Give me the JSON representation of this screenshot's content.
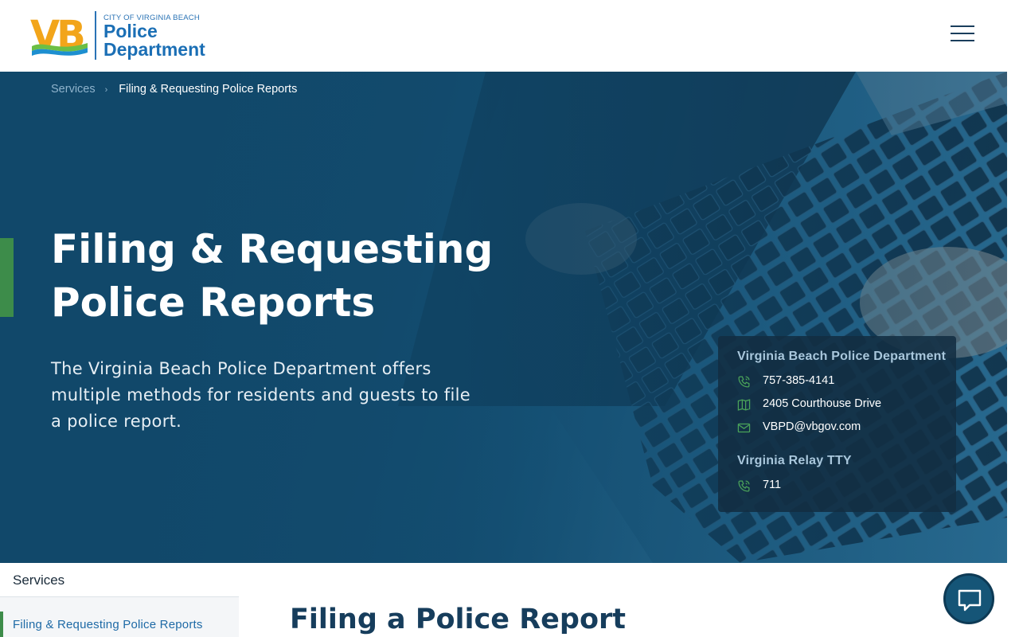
{
  "header": {
    "logo": {
      "small_text": "CITY OF VIRGINIA BEACH",
      "line1": "Police",
      "line2": "Department",
      "mark_text": "VB"
    },
    "menu_icon": "hamburger-menu-icon"
  },
  "breadcrumb": {
    "items": [
      {
        "label": "Services"
      },
      {
        "label": "Filing & Requesting Police Reports"
      }
    ],
    "separator_icon": "chevron-right-icon"
  },
  "hero": {
    "title": "Filing & Requesting Police Reports",
    "description": "The Virginia Beach Police Department offers multiple methods for residents and guests to file a police report."
  },
  "contact_card": {
    "department_heading": "Virginia Beach Police Department",
    "phone": "757-385-4141",
    "address": "2405 Courthouse Drive",
    "email": "VBPD@vbgov.com",
    "relay_heading": "Virginia Relay TTY",
    "relay_number": "711",
    "icons": [
      "phone-icon",
      "map-icon",
      "mail-icon",
      "phone-icon"
    ]
  },
  "sidebar": {
    "heading": "Services",
    "items": [
      {
        "label": "Filing & Requesting Police Reports",
        "active": true
      }
    ]
  },
  "main": {
    "section_title": "Filing a Police Report"
  },
  "chat": {
    "icon": "chat-bubble-icon"
  },
  "colors": {
    "brand_blue": "#1b6fb5",
    "hero_dark": "#0f4766",
    "accent_green": "#3d8c4a",
    "title_navy": "#163d5c",
    "link_blue": "#1e6aa6"
  }
}
